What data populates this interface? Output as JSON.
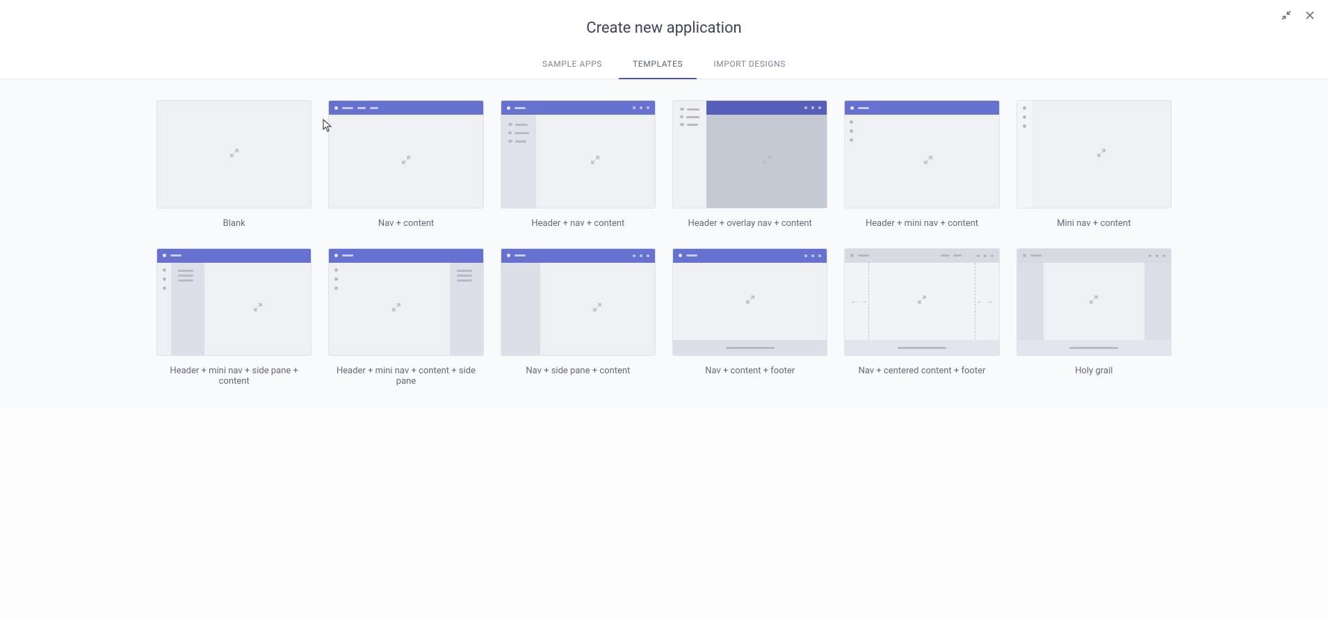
{
  "header": {
    "title": "Create new application"
  },
  "tabs": {
    "sample_apps": "SAMPLE APPS",
    "templates": "TEMPLATES",
    "import_designs": "IMPORT DESIGNS",
    "active": "templates"
  },
  "templates": {
    "blank": "Blank",
    "nav_content": "Nav + content",
    "header_nav_content": "Header + nav + content",
    "header_overlay_nav_content": "Header + overlay nav + content",
    "header_mini_nav_content": "Header + mini nav + content",
    "mini_nav_content": "Mini nav + content",
    "header_mini_side_content": "Header + mini nav + side pane + content",
    "header_mini_content_side": "Header + mini nav + content + side pane",
    "nav_side_content": "Nav + side pane + content",
    "nav_content_footer": "Nav + content + footer",
    "nav_centered_footer": "Nav + centered content + footer",
    "holy_grail": "Holy grail"
  }
}
